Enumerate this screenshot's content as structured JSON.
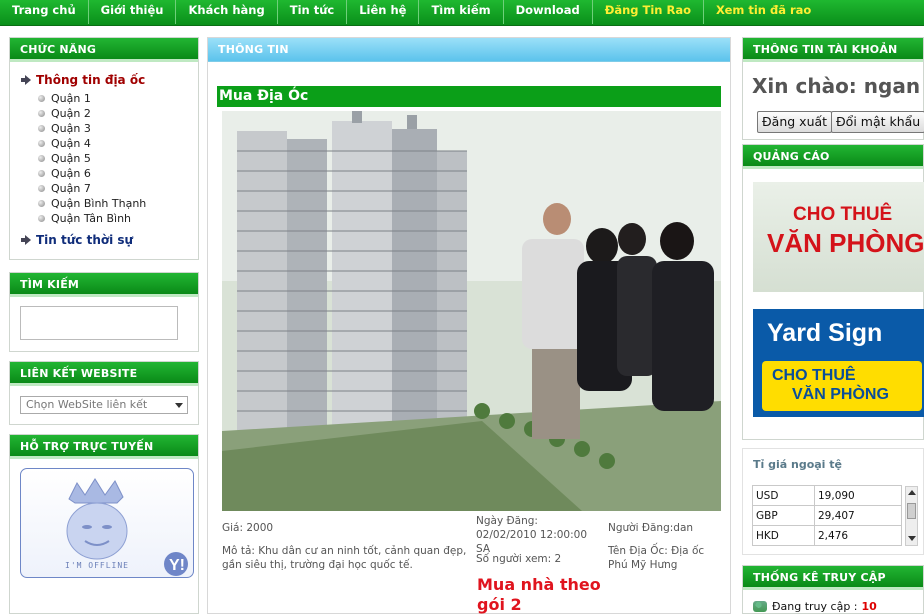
{
  "nav": {
    "items": [
      {
        "label": "Trang chủ"
      },
      {
        "label": "Giới thiệu"
      },
      {
        "label": "Khách hàng"
      },
      {
        "label": "Tin tức"
      },
      {
        "label": "Liên hệ"
      },
      {
        "label": "Tìm kiếm"
      },
      {
        "label": "Download"
      },
      {
        "label": "Đăng Tin Rao"
      },
      {
        "label": "Xem tin đã rao"
      }
    ]
  },
  "left": {
    "functions_title": "CHỨC NĂNG",
    "category_real_estate": "Thông tin địa ốc",
    "districts": [
      "Quận 1",
      "Quận 2",
      "Quận 3",
      "Quận 4",
      "Quận 5",
      "Quận 6",
      "Quận 7",
      "Quận Bình Thạnh",
      "Quận Tân Bình"
    ],
    "category_news": "Tin tức thời sự",
    "search_title": "TÌM KIẾM",
    "links_title": "LIÊN KẾT WEBSITE",
    "links_select": "Chọn WebSite liên kết",
    "support_title": "HỖ TRỢ TRỰC TUYẾN",
    "yahoo_status": "I'M OFFLINE"
  },
  "main": {
    "header": "THÔNG TIN",
    "title": "Mua Địa Óc",
    "price": "Giá: 2000",
    "description": "Mô tả: Khu dân cư an ninh tốt, cảnh quan đẹp, gần siêu thị, trường đại học quốc tế.",
    "post_date": "Ngày Đăng: 02/02/2010 12:00:00 SA",
    "views": "Số người xem: 2",
    "poster": "Người Đăng:dan",
    "place": "Tên Địa Ốc: Địa ốc Phú Mỹ Hưng",
    "promo": "Mua nhà theo gói 2"
  },
  "right": {
    "account_title": "THÔNG TIN TÀI KHOẢN",
    "greeting": "Xin chào: ngan",
    "logout_label": "Đăng xuất",
    "change_password_label": "Đổi mật khẩu",
    "ads_title": "QUẢNG CÁO",
    "ad1_line1": "CHO THUÊ",
    "ad1_line2": "VĂN PHÒNG",
    "ad2_brand": "Yard Sign",
    "ad2_line1": "CHO THUÊ",
    "ad2_line2": "VĂN PHÒNG",
    "rates_title": "Tỉ giá ngoại tệ",
    "rates": [
      {
        "code": "USD",
        "value": "19,090"
      },
      {
        "code": "GBP",
        "value": "29,407"
      },
      {
        "code": "HKD",
        "value": "2,476"
      }
    ],
    "stats_title": "THỐNG KÊ TRUY CẬP",
    "online_label": "Đang truy cập :",
    "online_count": "10"
  },
  "colors": {
    "nav_green": "#0a8f1a",
    "yellow_link": "#ffee33",
    "promo_red": "#e0141e",
    "header_blue": "#5cc3ec"
  }
}
